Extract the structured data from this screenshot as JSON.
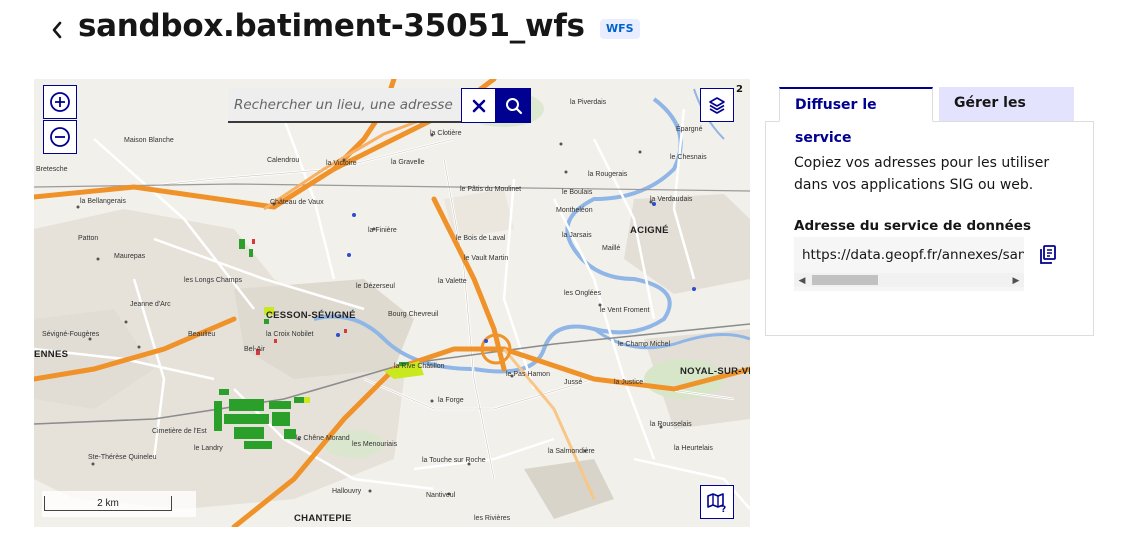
{
  "header": {
    "back_icon": "chevron-left-icon",
    "title": "sandbox.batiment-35051_wfs",
    "badge": "WFS"
  },
  "map": {
    "search": {
      "placeholder": "Rechercher un lieu, une adresse",
      "clear_icon": "close-icon",
      "submit_icon": "search-icon"
    },
    "zoom_in_icon": "plus-circle-icon",
    "zoom_out_icon": "minus-circle-icon",
    "layers_icon": "layers-icon",
    "layers_count": "2",
    "legend_icon": "map-legend-icon",
    "scale_label": "2 km",
    "labels": {
      "cesson": "CESSON-SÉVIGNÉ",
      "rennes": "ENNES",
      "acigne": "ACIGNÉ",
      "noyal": "NOYAL-SUR-VILA",
      "chantepie": "CHANTEPIE",
      "maison_blanche": "Maison Blanche",
      "bretesche": "Bretesche",
      "bellangerais": "la Bellangerais",
      "patton": "Patton",
      "maurepas": "Maurepas",
      "longs_champs": "les Longs Champs",
      "jeanne_darc": "Jeanne d'Arc",
      "sevigne_fougeres": "Sévigné-Fougères",
      "beaulieu": "Beaulieu",
      "cimetiere": "Cimetière de l'Est",
      "landry": "le Landry",
      "ste_therese": "Ste-Thérèse Quineleu",
      "calendrou": "Calendrou",
      "victoire": "la Victoire",
      "gravelle": "la Gravelle",
      "chateau_vaux": "Château de Vaux",
      "finiere": "la Finière",
      "dezerseul": "le Dézerseul",
      "bourg_chevreuil": "Bourg Chevreuil",
      "croix_nobilet": "la Croix Nobilet",
      "bel_air": "Bel-Air",
      "chene_morand": "le Chêne Morand",
      "menouriais": "les Menouriais",
      "forge": "la Forge",
      "touche_roche": "la Touche sur Roche",
      "halloubet": "Hallouvry",
      "nantiveul": "Nantiveul",
      "rivieres": "les Rivières",
      "clotiere": "la Clotière",
      "rougerais": "la Rougerais",
      "boulais": "le Boulais",
      "montheion": "Montheléon",
      "jarsais": "la Jarsais",
      "maille": "Maillé",
      "bois_laval": "le Bois de Laval",
      "vault_martin": "le Vault Martin",
      "valette": "la Valette",
      "ongles": "les Onglées",
      "vent_froment": "le Vent Froment",
      "champ_michel": "le Champ Michel",
      "pas_hamon": "le Pas Hamon",
      "jusse": "Jussé",
      "justice": "la Justice",
      "rousselais": "la Rousselais",
      "heurtelais": "la Heurtelais",
      "salmondiere": "la Salmondière",
      "piverdais": "la Piverdais",
      "epargne": "Épargné",
      "chesnais": "le Chesnais",
      "verdaudais": "la Verdaudais",
      "patis_moulinet": "le Pâtis du Moulinet",
      "chatillon": "la Rive Châtillon"
    }
  },
  "tabs": [
    {
      "label": "Diffuser le service",
      "active": true
    },
    {
      "label": "Gérer les styles",
      "active": false
    }
  ],
  "panel": {
    "description": "Copiez vos adresses pour les utiliser dans vos applications SIG ou web.",
    "address_label": "Adresse du service de données",
    "address_value": "https://data.geopf.fr/annexes/sandbox/wfs",
    "copy_icon": "copy-icon"
  },
  "colors": {
    "primary": "#000091",
    "road_major": "#f0922a",
    "building_green": "#2aa02a",
    "water": "#8fb6e6",
    "badge_bg": "#e8edff",
    "badge_text": "#0063cb"
  }
}
